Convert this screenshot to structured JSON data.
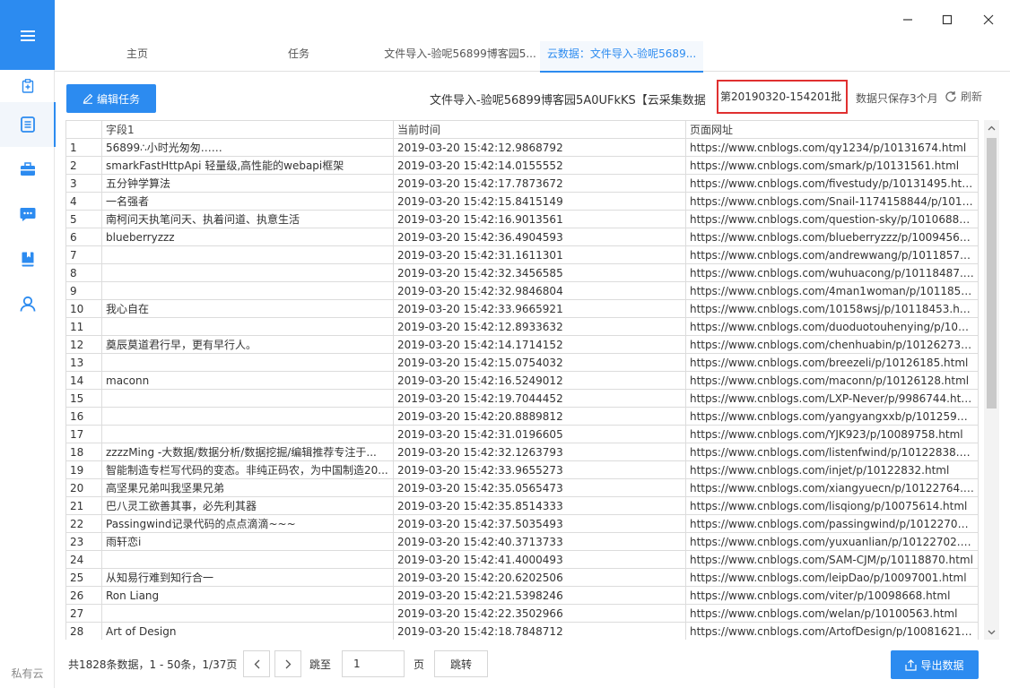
{
  "sidebar": {
    "footer_label": "私有云",
    "items": [
      {
        "icon": "clipboard-icon"
      },
      {
        "icon": "document-list-icon"
      },
      {
        "icon": "briefcase-icon"
      },
      {
        "icon": "chat-icon"
      },
      {
        "icon": "book-icon"
      },
      {
        "icon": "user-icon"
      }
    ]
  },
  "tabs": [
    {
      "label": "主页"
    },
    {
      "label": "任务"
    },
    {
      "label": "文件导入-验呢56899博客园5..."
    },
    {
      "label": "云数据：文件导入-验呢5689..."
    }
  ],
  "toolbar": {
    "edit_label": "编辑任务",
    "task_title": "文件导入-验呢56899博客园5A0UFkKS【云采集数据",
    "batch_label": "第20190320-154201批",
    "keep_note": "数据只保存3个月",
    "refresh_label": "刷新"
  },
  "table": {
    "columns": [
      "",
      "字段1",
      "当前时间",
      "页面网址"
    ],
    "rows": [
      [
        "1",
        "56899∴小时光匆匆……",
        "2019-03-20 15:42:12.9868792",
        "https://www.cnblogs.com/qy1234/p/10131674.html"
      ],
      [
        "2",
        "smarkFastHttpApi 轻量级,高性能的webapi框架",
        "2019-03-20 15:42:14.0155552",
        "https://www.cnblogs.com/smark/p/10131561.html"
      ],
      [
        "3",
        "五分钟学算法",
        "2019-03-20 15:42:17.7873672",
        "https://www.cnblogs.com/fivestudy/p/10131495.html"
      ],
      [
        "4",
        "一名强者",
        "2019-03-20 15:42:15.8415149",
        "https://www.cnblogs.com/Snail-1174158844/p/1010..."
      ],
      [
        "5",
        "南柯问天执笔问天、执着问道、执意生活",
        "2019-03-20 15:42:16.9013561",
        "https://www.cnblogs.com/question-sky/p/10106884...."
      ],
      [
        "6",
        "blueberryzzz",
        "2019-03-20 15:42:36.4904593",
        "https://www.cnblogs.com/blueberryzzz/p/10094560...."
      ],
      [
        "7",
        "",
        "2019-03-20 15:42:31.1611301",
        "https://www.cnblogs.com/andrewwang/p/10118578...."
      ],
      [
        "8",
        "",
        "2019-03-20 15:42:32.3456585",
        "https://www.cnblogs.com/wuhuacong/p/10118487.h..."
      ],
      [
        "9",
        "",
        "2019-03-20 15:42:32.9846804",
        "https://www.cnblogs.com/4man1woman/p/1011853..."
      ],
      [
        "10",
        "我心自在",
        "2019-03-20 15:42:33.9665921",
        "https://www.cnblogs.com/10158wsj/p/10118453.html"
      ],
      [
        "11",
        "",
        "2019-03-20 15:42:12.8933632",
        "https://www.cnblogs.com/duoduotouhenying/p/101..."
      ],
      [
        "12",
        "奠辰莫道君行早，更有早行人。",
        "2019-03-20 15:42:14.1714152",
        "https://www.cnblogs.com/chenhuabin/p/10126273.h..."
      ],
      [
        "13",
        "",
        "2019-03-20 15:42:15.0754032",
        "https://www.cnblogs.com/breezeli/p/10126185.html"
      ],
      [
        "14",
        "maconn",
        "2019-03-20 15:42:16.5249012",
        "https://www.cnblogs.com/maconn/p/10126128.html"
      ],
      [
        "15",
        "",
        "2019-03-20 15:42:19.7044452",
        "https://www.cnblogs.com/LXP-Never/p/9986744.html"
      ],
      [
        "16",
        "",
        "2019-03-20 15:42:20.8889812",
        "https://www.cnblogs.com/yangyangxxb/p/10125913...."
      ],
      [
        "17",
        "",
        "2019-03-20 15:42:31.0196605",
        "https://www.cnblogs.com/YJK923/p/10089758.html"
      ],
      [
        "18",
        "zzzzMing -大数据/数据分析/数据挖掘/编辑推荐专注于...",
        "2019-03-20 15:42:32.1263793",
        "https://www.cnblogs.com/listenfwind/p/10122838.ht..."
      ],
      [
        "19",
        "智能制造专栏写代码的变态。非纯正码农，为中国制造20...",
        "2019-03-20 15:42:33.9655273",
        "https://www.cnblogs.com/injet/p/10122832.html"
      ],
      [
        "20",
        "高坚果兄弟叫我坚果兄弟",
        "2019-03-20 15:42:35.0565473",
        "https://www.cnblogs.com/xiangyuecn/p/10122764.ht..."
      ],
      [
        "21",
        "巴八灵工欲善其事，必先利其器",
        "2019-03-20 15:42:35.8514333",
        "https://www.cnblogs.com/lisqiong/p/10075614.html"
      ],
      [
        "22",
        "Passingwind记录代码的点点滴滴~~~",
        "2019-03-20 15:42:37.5035493",
        "https://www.cnblogs.com/passingwind/p/10122705...."
      ],
      [
        "23",
        "雨轩恋i",
        "2019-03-20 15:42:40.3713733",
        "https://www.cnblogs.com/yuxuanlian/p/10122702.html"
      ],
      [
        "24",
        "",
        "2019-03-20 15:42:41.4000493",
        "https://www.cnblogs.com/SAM-CJM/p/10118870.html"
      ],
      [
        "25",
        "从知易行难到知行合一",
        "2019-03-20 15:42:20.6202506",
        "https://www.cnblogs.com/leipDao/p/10097001.html"
      ],
      [
        "26",
        "Ron Liang",
        "2019-03-20 15:42:21.5398246",
        "https://www.cnblogs.com/viter/p/10098668.html"
      ],
      [
        "27",
        "",
        "2019-03-20 15:42:22.3502966",
        "https://www.cnblogs.com/welan/p/10100563.html"
      ],
      [
        "28",
        "Art of Design",
        "2019-03-20 15:42:18.7848712",
        "https://www.cnblogs.com/ArtofDesign/p/10081621.h..."
      ]
    ]
  },
  "pager": {
    "info": "共1828条数据，1 - 50条，1/37页",
    "goto_label": "跳至",
    "page_value": "1",
    "page_suffix": "页",
    "jump_label": "跳转",
    "export_label": "导出数据"
  }
}
